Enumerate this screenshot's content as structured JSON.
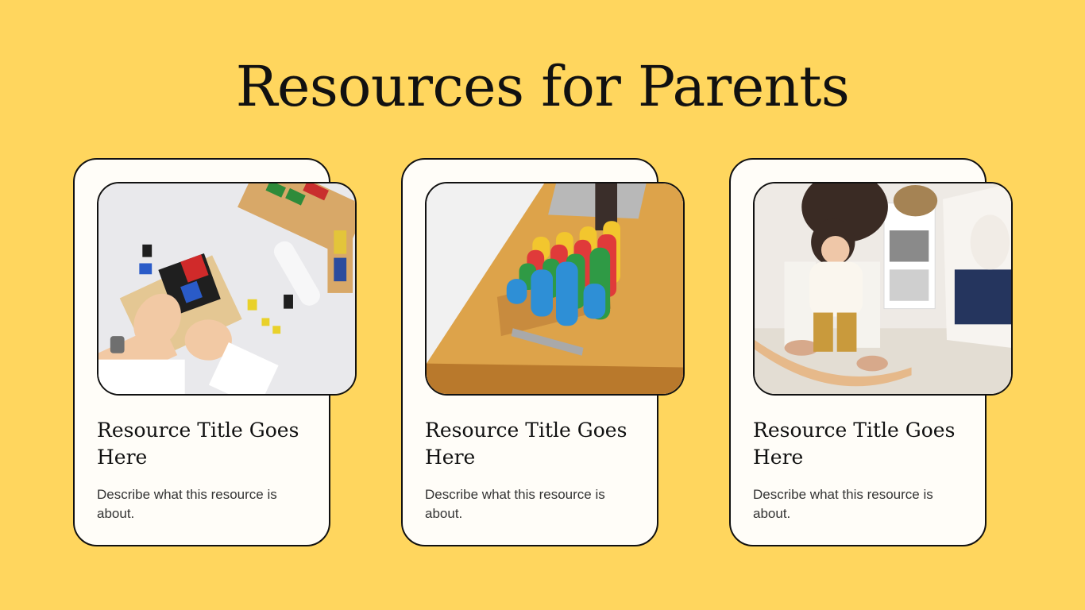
{
  "page": {
    "title": "Resources for Parents",
    "background_color": "#FFD65E",
    "card_color": "#FFFDF8",
    "outline_color": "#111111"
  },
  "cards": [
    {
      "title": "Resource Title Goes Here",
      "description": "Describe what this resource is about.",
      "photo_icon": "child-hands-color-cube-photo"
    },
    {
      "title": "Resource Title Goes Here",
      "description": "Describe what this resource is about.",
      "photo_icon": "colored-cylinder-blocks-photo"
    },
    {
      "title": "Resource Title Goes Here",
      "description": "Describe what this resource is about.",
      "photo_icon": "child-balance-board-photo"
    }
  ]
}
